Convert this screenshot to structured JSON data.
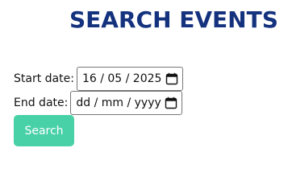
{
  "page": {
    "title": "SEARCH EVENTS"
  },
  "form": {
    "start_label": "Start date:",
    "start_value": "16 / 05 / 2025",
    "end_label": "End date:",
    "end_placeholder": "dd / mm / yyyy",
    "search_label": "Search"
  },
  "icons": {
    "date_picker": "calendar-icon"
  },
  "colors": {
    "title": "#14327e",
    "button_background": "#48d1a7",
    "button_text": "#ffffff"
  }
}
